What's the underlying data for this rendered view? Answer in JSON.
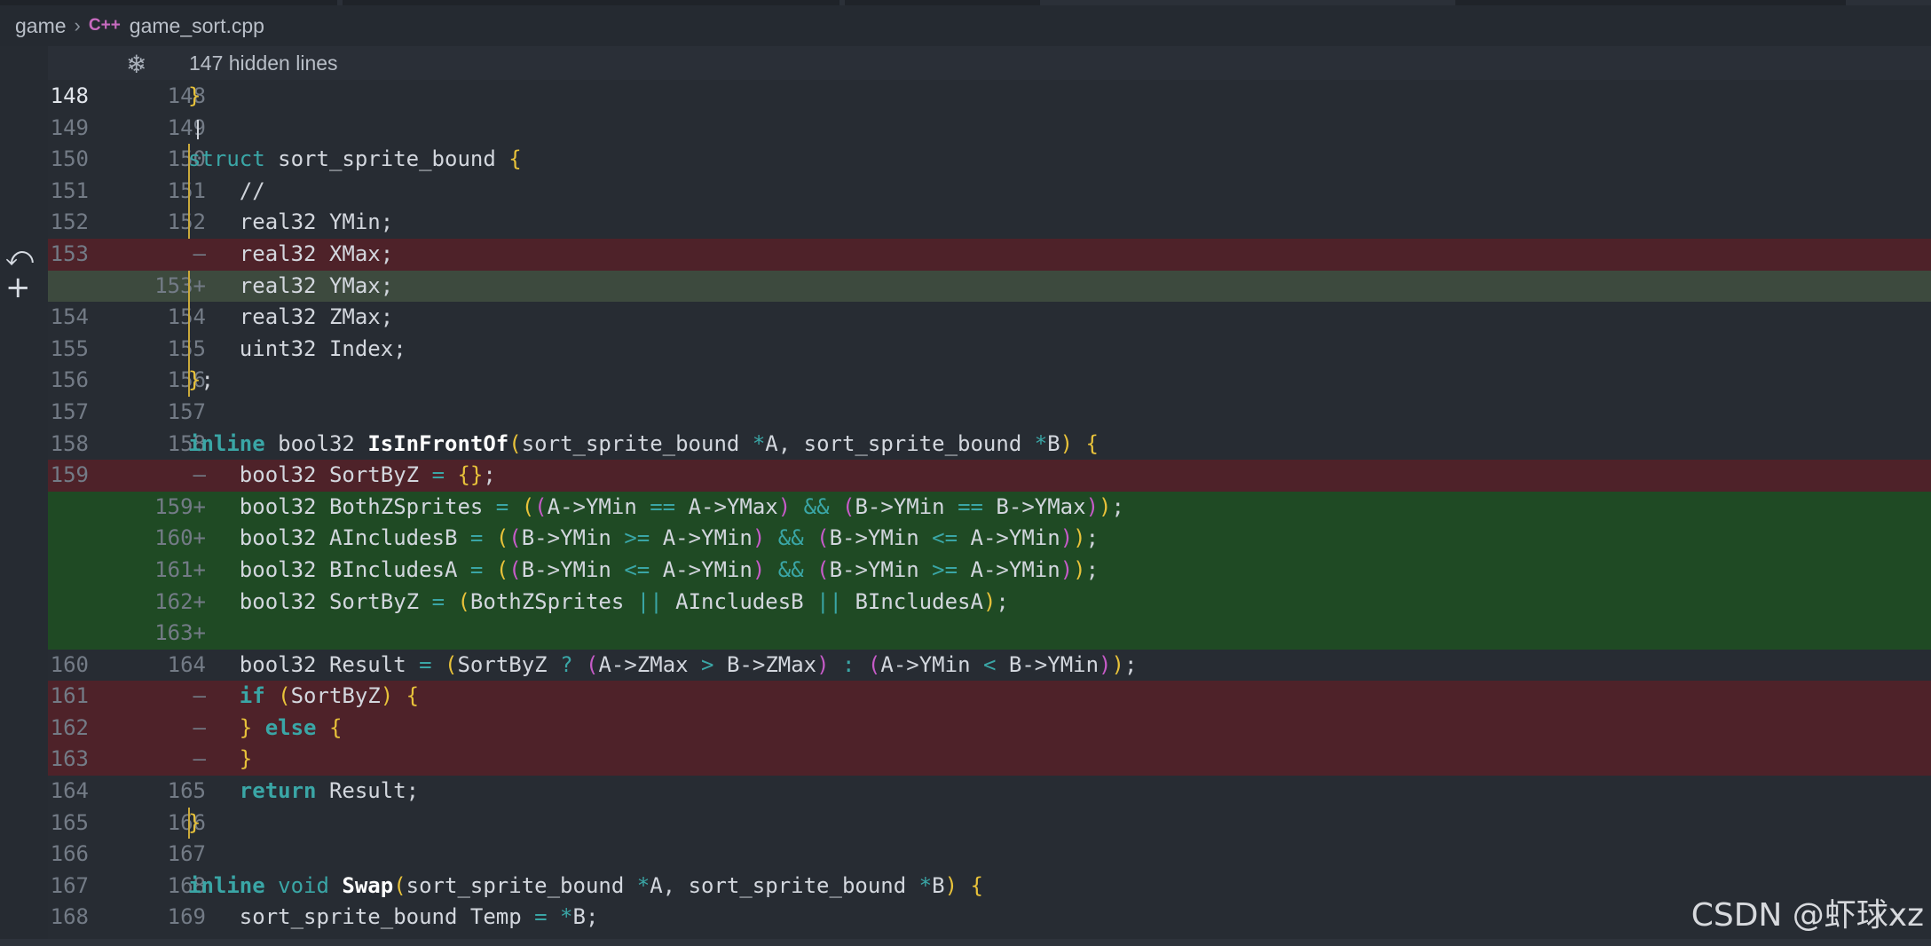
{
  "breadcrumb": {
    "folder": "game",
    "separator": "›",
    "file_icon": "C++",
    "file": "game_sort.cpp"
  },
  "hidden_lines": {
    "label": "147 hidden lines"
  },
  "watermark": "CSDN @虾球xz",
  "lines": [
    {
      "old": "148",
      "new": "148",
      "kind": "ctx",
      "code": "}"
    },
    {
      "old": "149",
      "new": "149",
      "kind": "ctx",
      "code": ""
    },
    {
      "old": "150",
      "new": "150",
      "kind": "ctx",
      "code": "struct sort_sprite_bound {"
    },
    {
      "old": "151",
      "new": "151",
      "kind": "ctx",
      "code": "    //"
    },
    {
      "old": "152",
      "new": "152",
      "kind": "ctx",
      "code": "    real32 YMin;"
    },
    {
      "old": "153",
      "new": "—",
      "kind": "del",
      "code": "    real32 XMax;"
    },
    {
      "old": "",
      "new": "153+",
      "kind": "mod",
      "code": "    real32 YMax;"
    },
    {
      "old": "154",
      "new": "154",
      "kind": "ctx",
      "code": "    real32 ZMax;"
    },
    {
      "old": "155",
      "new": "155",
      "kind": "ctx",
      "code": "    uint32 Index;"
    },
    {
      "old": "156",
      "new": "156",
      "kind": "ctx",
      "code": "};"
    },
    {
      "old": "157",
      "new": "157",
      "kind": "ctx",
      "code": ""
    },
    {
      "old": "158",
      "new": "158",
      "kind": "ctx",
      "code": "inline bool32 IsInFrontOf(sort_sprite_bound *A, sort_sprite_bound *B) {"
    },
    {
      "old": "159",
      "new": "—",
      "kind": "del",
      "code": "    bool32 SortByZ = {};"
    },
    {
      "old": "",
      "new": "159+",
      "kind": "add",
      "code": "    bool32 BothZSprites = ((A->YMin == A->YMax) && (B->YMin == B->YMax));"
    },
    {
      "old": "",
      "new": "160+",
      "kind": "add",
      "code": "    bool32 AIncludesB = ((B->YMin >= A->YMin) && (B->YMin <= A->YMin));"
    },
    {
      "old": "",
      "new": "161+",
      "kind": "add",
      "code": "    bool32 BIncludesA = ((B->YMin <= A->YMin) && (B->YMin >= A->YMin));"
    },
    {
      "old": "",
      "new": "162+",
      "kind": "add",
      "code": "    bool32 SortByZ = (BothZSprites || AIncludesB || BIncludesA);"
    },
    {
      "old": "",
      "new": "163+",
      "kind": "add",
      "code": ""
    },
    {
      "old": "160",
      "new": "164",
      "kind": "ctx",
      "code": "    bool32 Result = (SortByZ ? (A->ZMax > B->ZMax) : (A->YMin < B->YMin));"
    },
    {
      "old": "161",
      "new": "—",
      "kind": "del",
      "code": "    if (SortByZ) {"
    },
    {
      "old": "162",
      "new": "—",
      "kind": "del",
      "code": "    } else {"
    },
    {
      "old": "163",
      "new": "—",
      "kind": "del",
      "code": "    }"
    },
    {
      "old": "164",
      "new": "165",
      "kind": "ctx",
      "code": "    return Result;"
    },
    {
      "old": "165",
      "new": "166",
      "kind": "ctx",
      "code": "}"
    },
    {
      "old": "166",
      "new": "167",
      "kind": "ctx",
      "code": ""
    },
    {
      "old": "167",
      "new": "168",
      "kind": "ctx",
      "code": "inline void Swap(sort_sprite_bound *A, sort_sprite_bound *B) {"
    },
    {
      "old": "168",
      "new": "169",
      "kind": "ctx",
      "code": "    sort_sprite_bound Temp = *B;"
    }
  ]
}
